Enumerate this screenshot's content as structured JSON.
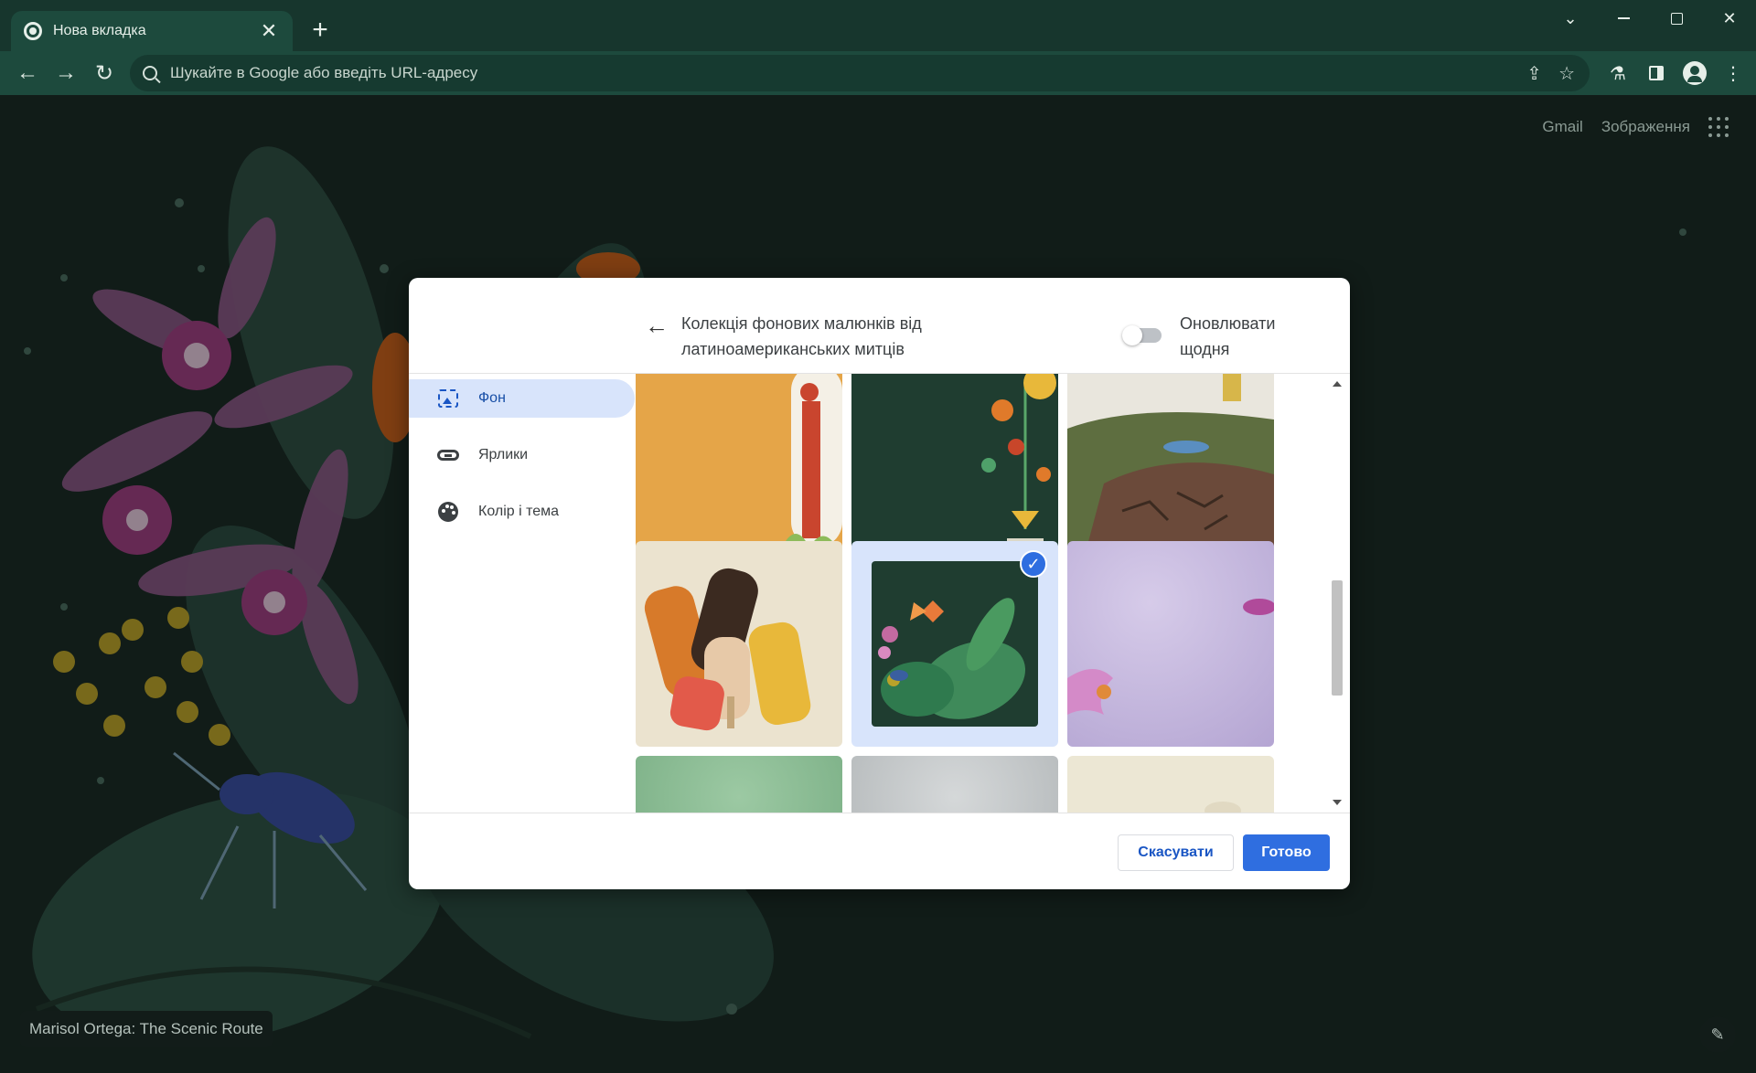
{
  "browser": {
    "tab_title": "Нова вкладка",
    "tab_close": "✕",
    "new_tab": "+",
    "omnibox_placeholder": "Шукайте в Google або введіть URL-адресу"
  },
  "ntp": {
    "header_links": [
      "Gmail",
      "Зображення"
    ],
    "attribution": "Marisol Ortega: The Scenic Route"
  },
  "dialog": {
    "title": "Колекція фонових малюнків від латиноамериканських митців",
    "toggle_label": "Оновлювати щодня",
    "toggle_on": false,
    "sidebar": [
      {
        "label": "Фон",
        "icon": "wallpaper-icon",
        "active": true
      },
      {
        "label": "Ярлики",
        "icon": "link-icon",
        "active": false
      },
      {
        "label": "Колір і тема",
        "icon": "palette-icon",
        "active": false
      }
    ],
    "selected_tile_index": 4,
    "tiles": [
      {
        "name": "wallpaper-tile-orange-mirror"
      },
      {
        "name": "wallpaper-tile-folk-flowers"
      },
      {
        "name": "wallpaper-tile-cracked-earth"
      },
      {
        "name": "wallpaper-tile-ice-pops"
      },
      {
        "name": "wallpaper-tile-scenic-route"
      },
      {
        "name": "wallpaper-tile-lavender"
      },
      {
        "name": "wallpaper-tile-green"
      },
      {
        "name": "wallpaper-tile-grey"
      },
      {
        "name": "wallpaper-tile-cream"
      }
    ],
    "cancel_label": "Скасувати",
    "done_label": "Готово"
  },
  "colors": {
    "accent": "#2f6ee0",
    "chrome": "#1d4a3d",
    "active_nav": "#d8e4fb"
  }
}
